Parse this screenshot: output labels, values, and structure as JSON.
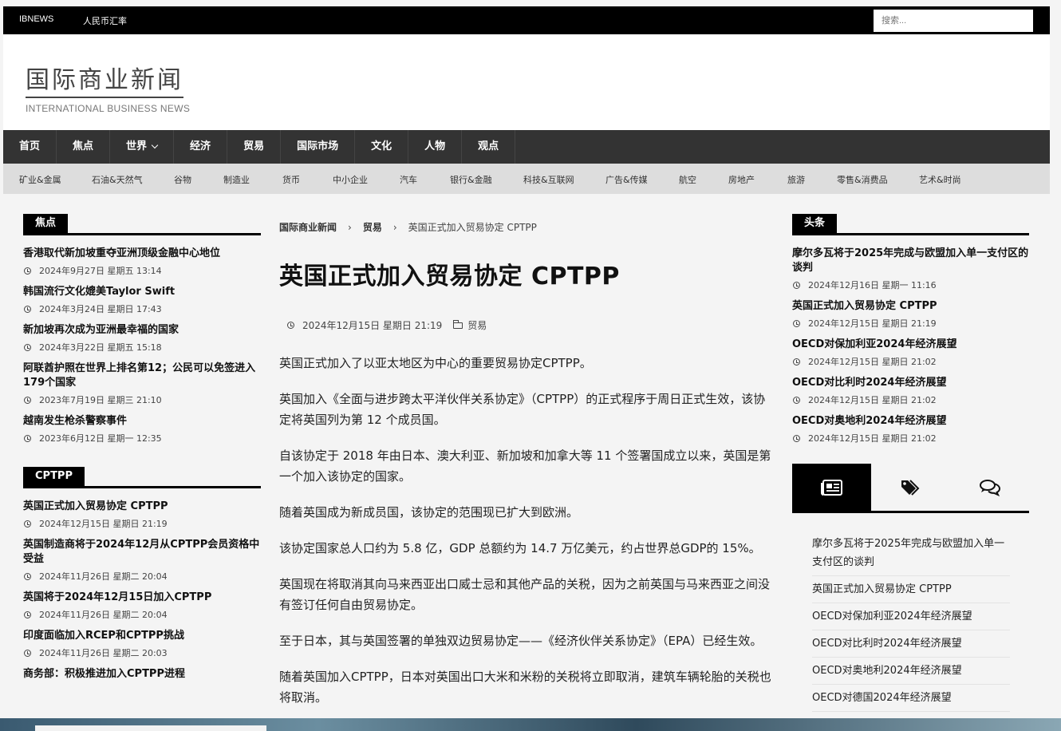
{
  "topbar": {
    "links": [
      "IBNEWS",
      "人民币汇率"
    ],
    "search_placeholder": "搜索..."
  },
  "logo": {
    "cn": "国际商业新闻",
    "en": "INTERNATIONAL BUSINESS NEWS"
  },
  "mainnav": [
    "首页",
    "焦点",
    "世界",
    "经济",
    "贸易",
    "国际市场",
    "文化",
    "人物",
    "观点"
  ],
  "subnav": [
    "矿业&金属",
    "石油&天然气",
    "谷物",
    "制造业",
    "货币",
    "中小企业",
    "汽车",
    "银行&金融",
    "科技&互联网",
    "广告&传媒",
    "航空",
    "房地产",
    "旅游",
    "零售&消费品",
    "艺术&时尚"
  ],
  "left": {
    "focus_title": "焦点",
    "focus_posts": [
      {
        "title": "香港取代新加坡重夺亚洲顶级金融中心地位",
        "date": "2024年9月27日 星期五 13:14"
      },
      {
        "title": "韩国流行文化媲美Taylor Swift",
        "date": "2024年3月24日 星期日 17:43"
      },
      {
        "title": "新加坡再次成为亚洲最幸福的国家",
        "date": "2024年3月22日 星期五 15:18"
      },
      {
        "title": "阿联酋护照在世界上排名第12；公民可以免签进入179个国家",
        "date": "2023年7月19日 星期三 21:10"
      },
      {
        "title": "越南发生枪杀警察事件",
        "date": "2023年6月12日 星期一 12:35"
      }
    ],
    "cptpp_title": "CPTPP",
    "cptpp_posts": [
      {
        "title": "英国正式加入贸易协定 CPTPP",
        "date": "2024年12月15日 星期日 21:19"
      },
      {
        "title": "英国制造商将于2024年12月从CPTPP会员资格中受益",
        "date": "2024年11月26日 星期二 20:04"
      },
      {
        "title": "英国将于2024年12月15日加入CPTPP",
        "date": "2024年11月26日 星期二 20:04"
      },
      {
        "title": "印度面临加入RCEP和CPTPP挑战",
        "date": "2024年11月26日 星期二 20:03"
      },
      {
        "title": "商务部：积极推进加入CPTPP进程",
        "date": ""
      }
    ]
  },
  "article": {
    "breadcrumb": [
      "国际商业新闻",
      "贸易",
      "英国正式加入贸易协定 CPTPP"
    ],
    "title": "英国正式加入贸易协定 CPTPP",
    "date": "2024年12月15日 星期日 21:19",
    "category": "贸易",
    "paragraphs": [
      "英国正式加入了以亚太地区为中心的重要贸易协定CPTPP。",
      "英国加入《全面与进步跨太平洋伙伴关系协定》（CPTPP）的正式程序于周日正式生效，该协定将英国列为第 12 个成员国。",
      "自该协定于 2018 年由日本、澳大利亚、新加坡和加拿大等 11 个签署国成立以来，英国是第一个加入该协定的国家。",
      "随着英国成为新成员国，该协定的范围现已扩大到欧洲。",
      "该协定国家总人口约为 5.8 亿，GDP 总额约为 14.7 万亿美元，约占世界总GDP的 15%。",
      "英国现在将取消其向马来西亚出口威士忌和其他产品的关税，因为之前英国与马来西亚之间没有签订任何自由贸易协定。",
      "至于日本，其与英国签署的单独双边贸易协定——《经济伙伴关系协定》（EPA）已经生效。",
      "随着英国加入CPTPP，日本对英国出口大米和米粉的关税将立即取消，建筑车辆轮胎的关税也将取消。"
    ]
  },
  "right": {
    "head_title": "头条",
    "head_posts": [
      {
        "title": "摩尔多瓦将于2025年完成与欧盟加入单一支付区的谈判",
        "date": "2024年12月16日 星期一 11:16"
      },
      {
        "title": "英国正式加入贸易协定 CPTPP",
        "date": "2024年12月15日 星期日 21:19"
      },
      {
        "title": "OECD对保加利亚2024年经济展望",
        "date": "2024年12月15日 星期日 21:02"
      },
      {
        "title": "OECD对比利时2024年经济展望",
        "date": "2024年12月15日 星期日 21:02"
      },
      {
        "title": "OECD对奥地利2024年经济展望",
        "date": "2024年12月15日 星期日 21:02"
      }
    ],
    "tab_list": [
      "摩尔多瓦将于2025年完成与欧盟加入单一支付区的谈判",
      "英国正式加入贸易协定 CPTPP",
      "OECD对保加利亚2024年经济展望",
      "OECD对比利时2024年经济展望",
      "OECD对奥地利2024年经济展望",
      "OECD对德国2024年经济展望"
    ]
  }
}
